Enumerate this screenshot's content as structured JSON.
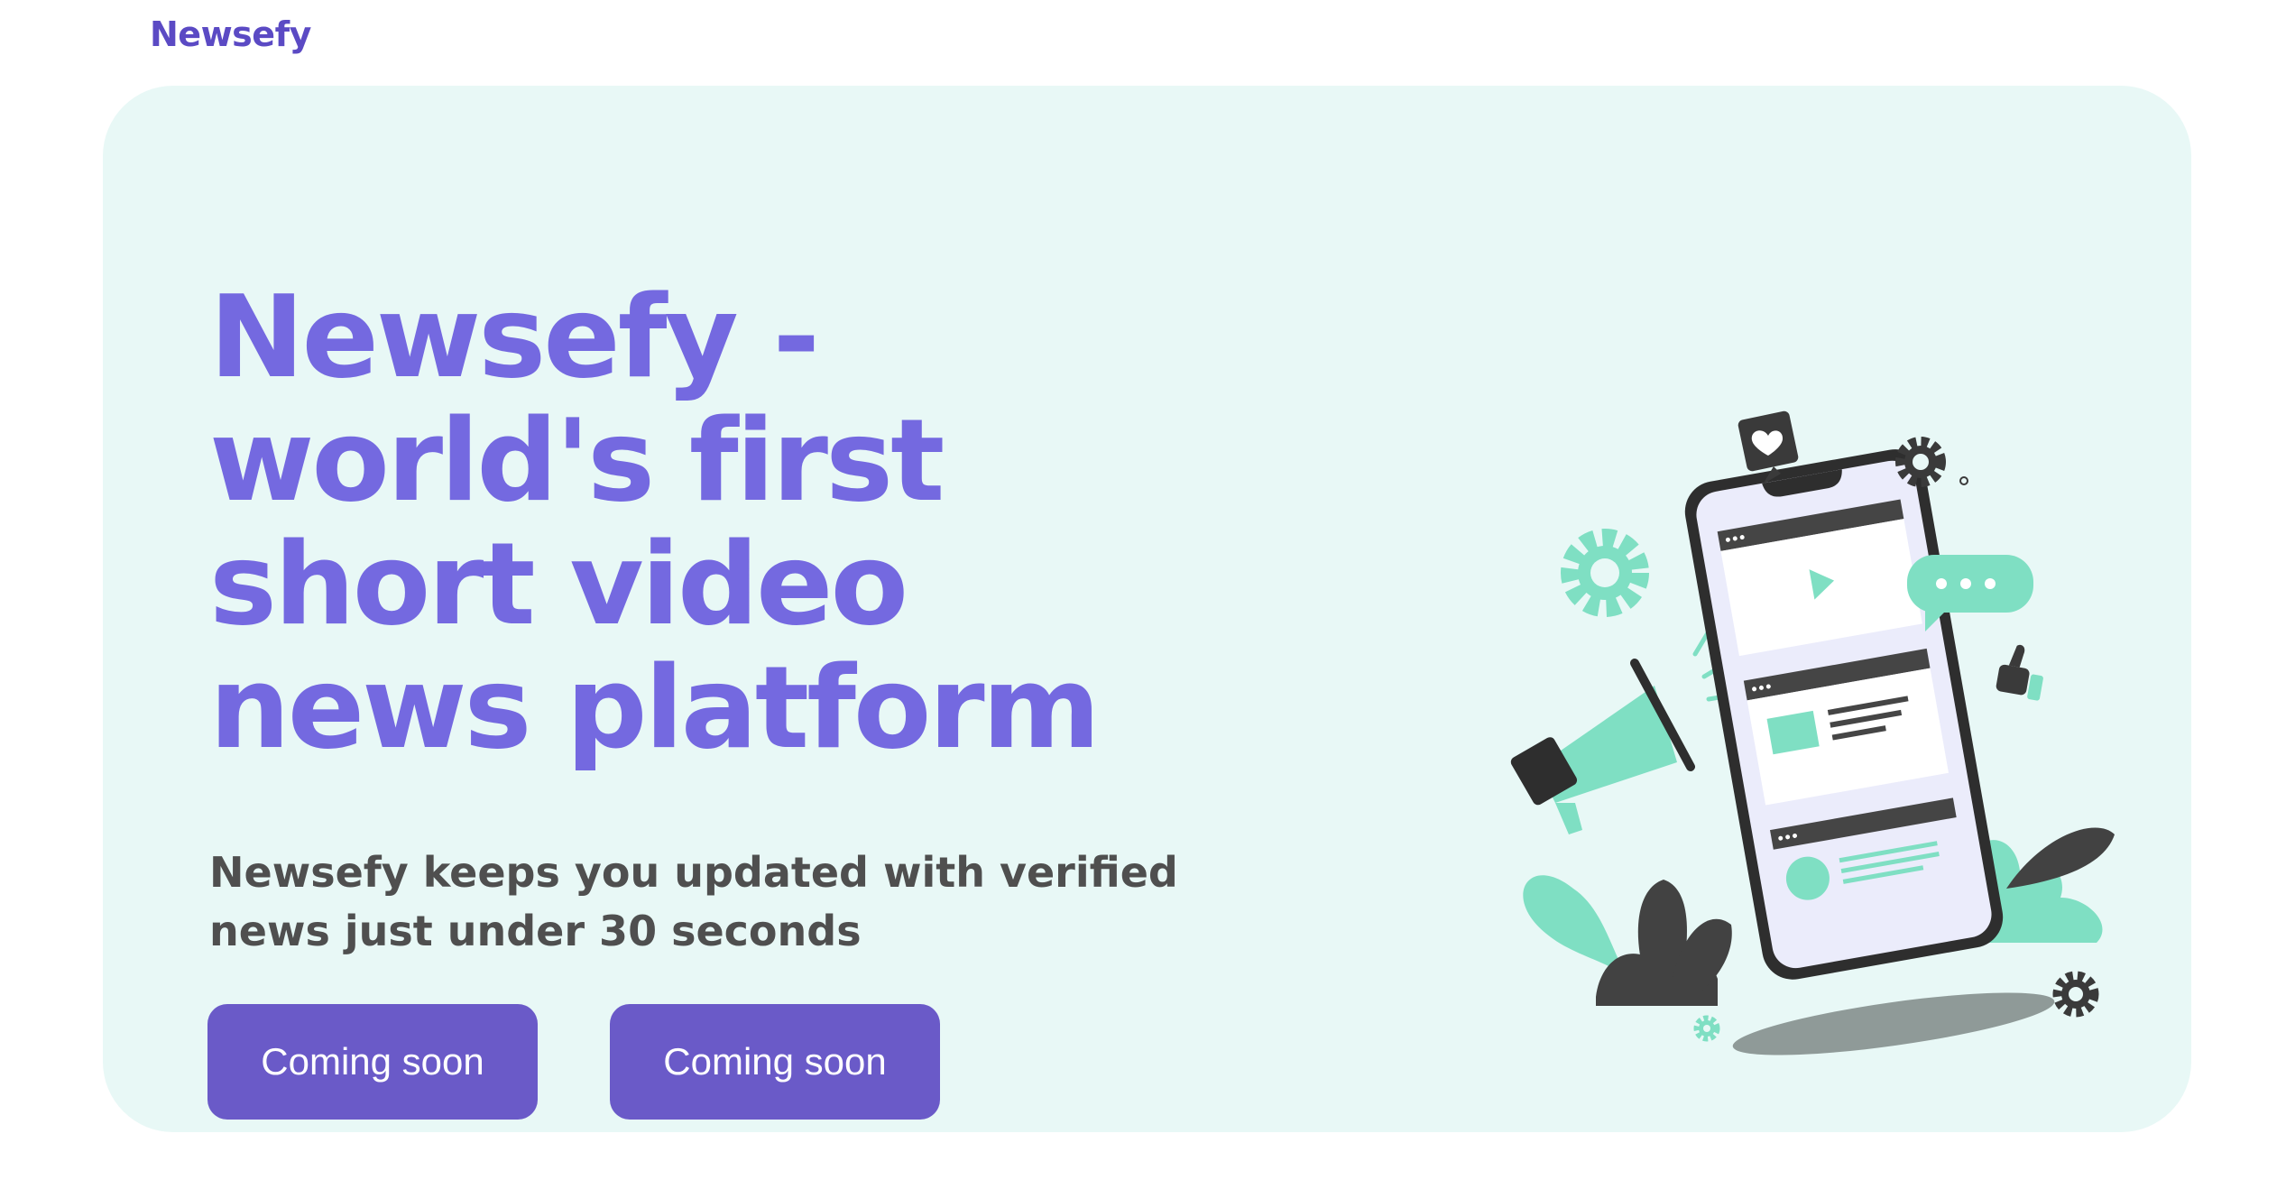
{
  "header": {
    "brand": "Newsefy"
  },
  "hero": {
    "headline_lines": [
      "Newsefy -",
      "world's first",
      "short video",
      "news platform"
    ],
    "subtitle_lines": [
      "Newsefy keeps you updated with verified",
      "news just under 30 seconds"
    ],
    "buttons": [
      {
        "label": "Coming soon"
      },
      {
        "label": "Coming soon"
      }
    ]
  },
  "colors": {
    "brand": "#5b4ac4",
    "headline": "#7469e0",
    "button": "#6a5ac8",
    "hero_background": "#e8f8f6",
    "accent_mint": "#7fdfc3",
    "dark": "#3a3a3a"
  },
  "illustration": {
    "icons": [
      "gear-icon",
      "heart-message-icon",
      "chat-bubble-icon",
      "megaphone-icon",
      "thumbs-up-icon",
      "play-icon",
      "user-icon"
    ]
  }
}
